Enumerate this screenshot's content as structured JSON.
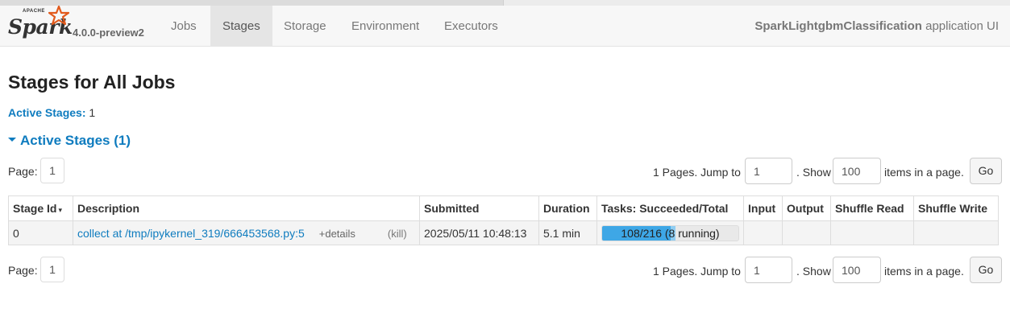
{
  "navbar": {
    "brand_apache": "APACHE",
    "brand_name": "Spark",
    "version": "4.0.0-preview2",
    "tabs": [
      {
        "label": "Jobs"
      },
      {
        "label": "Stages"
      },
      {
        "label": "Storage"
      },
      {
        "label": "Environment"
      },
      {
        "label": "Executors"
      }
    ],
    "active_tab": "Stages",
    "app_name": "SparkLightgbmClassification",
    "app_suffix": " application UI"
  },
  "page": {
    "title": "Stages for All Jobs",
    "summary_label": "Active Stages:",
    "summary_value": " 1",
    "section_title": "Active Stages (1)"
  },
  "pager_top": {
    "page_label": "Page:",
    "current_page": "1",
    "pages_text": "1 Pages. Jump to",
    "jump_value": "1",
    "show_text": ". Show",
    "show_value": "100",
    "items_text": "items in a page.",
    "go_label": "Go"
  },
  "pager_bottom": {
    "page_label": "Page:",
    "current_page": "1",
    "pages_text": "1 Pages. Jump to",
    "jump_value": "1",
    "show_text": ". Show",
    "show_value": "100",
    "items_text": "items in a page.",
    "go_label": "Go"
  },
  "table": {
    "headers": [
      "Stage Id",
      "Description",
      "Submitted",
      "Duration",
      "Tasks: Succeeded/Total",
      "Input",
      "Output",
      "Shuffle Read",
      "Shuffle Write"
    ],
    "sort_indicator": "▾",
    "rows": [
      {
        "stage_id": "0",
        "description": "collect at /tmp/ipykernel_319/666453568.py:5",
        "details": "+details",
        "kill": "(kill)",
        "submitted": "2025/05/11 10:48:13",
        "duration": "5.1 min",
        "tasks_text": "108/216 (8 running)",
        "tasks_succeeded": 108,
        "tasks_running": 8,
        "tasks_total": 216,
        "input": "",
        "output": "",
        "shuffle_read": "",
        "shuffle_write": ""
      }
    ]
  },
  "colors": {
    "link": "#0f7cbf",
    "progress_done": "#3ea7e6",
    "progress_running": "#8fcdf2"
  }
}
